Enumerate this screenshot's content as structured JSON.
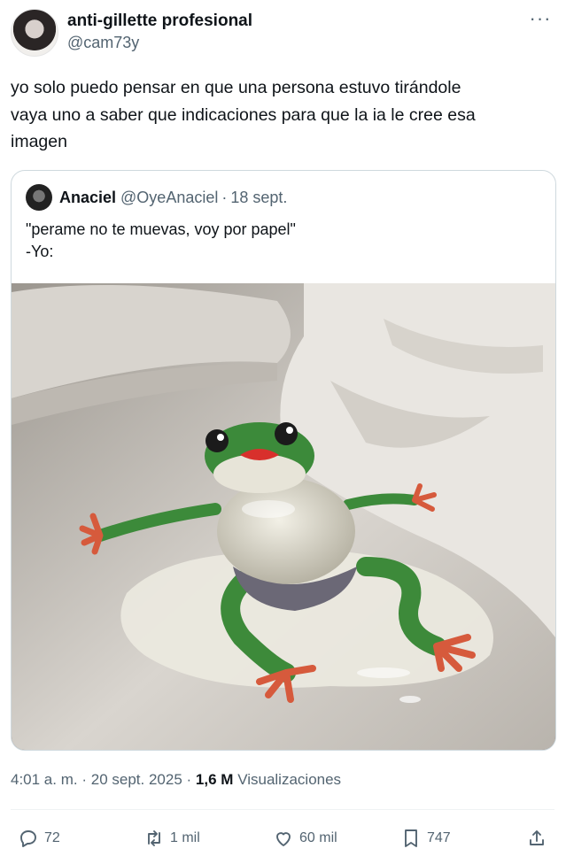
{
  "author": {
    "display_name": "anti-gillette profesional",
    "handle": "@cam73y"
  },
  "tweet": {
    "text_lines": [
      "yo solo puedo pensar en que una persona estuvo tirándole",
      "vaya uno a saber que indicaciones para que la ia le cree esa",
      "imagen"
    ]
  },
  "quoted": {
    "name": "Anaciel",
    "handle": "@OyeAnaciel",
    "separator": "·",
    "date": "18 sept.",
    "text_line1": "\"perame no te muevas, voy por papel\"",
    "text_line2": "-Yo:"
  },
  "meta": {
    "time": "4:01 a. m.",
    "separator": "·",
    "date": "20 sept. 2025",
    "views_count": "1,6 M",
    "views_label": "Visualizaciones"
  },
  "actions": {
    "replies": "72",
    "reposts": "1 mil",
    "likes": "60 mil",
    "bookmarks": "747"
  },
  "icons": [
    "more-icon",
    "reply-icon",
    "repost-icon",
    "like-icon",
    "bookmark-icon",
    "share-icon"
  ]
}
